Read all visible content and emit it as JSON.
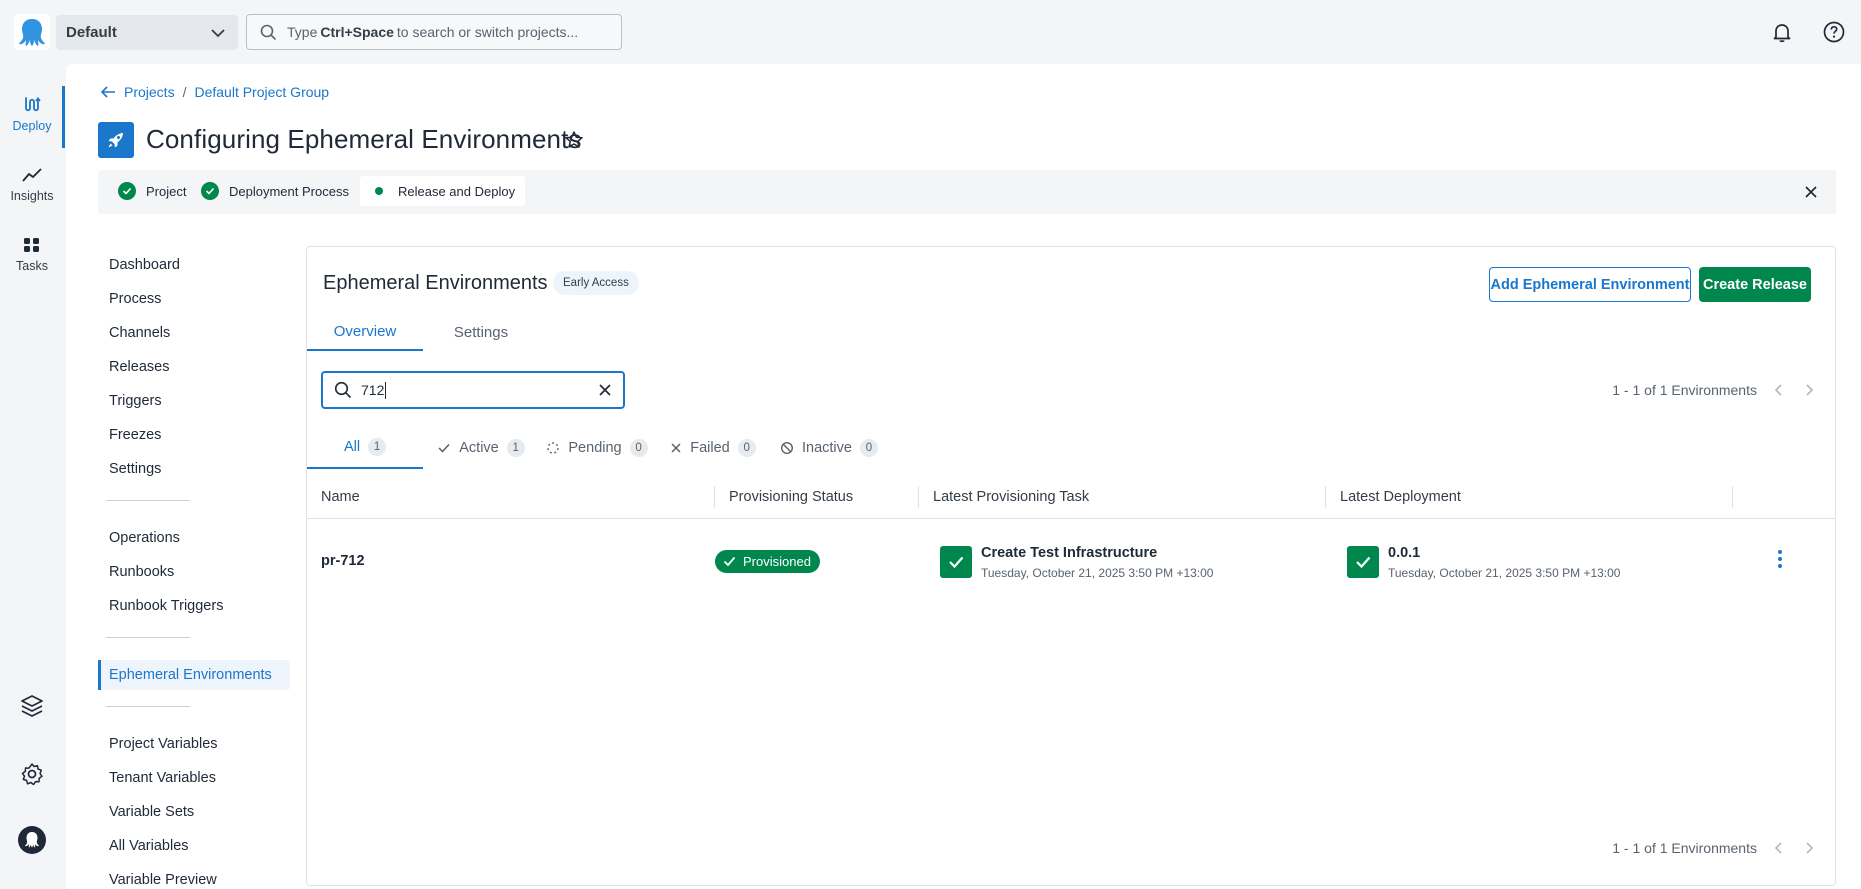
{
  "topbar": {
    "space_name": "Default",
    "search_prefix": "Type",
    "search_shortcut": "Ctrl+Space",
    "search_suffix": "to search or switch projects..."
  },
  "rail": {
    "items": [
      {
        "label": "Deploy",
        "icon": "deploy-icon"
      },
      {
        "label": "Insights",
        "icon": "insights-icon"
      },
      {
        "label": "Tasks",
        "icon": "tasks-icon"
      }
    ]
  },
  "breadcrumb": {
    "projects": "Projects",
    "sep": "/",
    "group": "Default Project Group"
  },
  "page": {
    "title": "Configuring Ephemeral Environments"
  },
  "steps": [
    {
      "label": "Project",
      "state": "done"
    },
    {
      "label": "Deployment Process",
      "state": "done"
    },
    {
      "label": "Release and Deploy",
      "state": "current"
    }
  ],
  "sidenav": {
    "group1": [
      "Dashboard",
      "Process",
      "Channels",
      "Releases",
      "Triggers",
      "Freezes",
      "Settings"
    ],
    "group2": [
      "Operations",
      "Runbooks",
      "Runbook Triggers"
    ],
    "group3": [
      "Ephemeral Environments"
    ],
    "group4": [
      "Project Variables",
      "Tenant Variables",
      "Variable Sets",
      "All Variables",
      "Variable Preview"
    ]
  },
  "card": {
    "title": "Ephemeral Environments",
    "badge": "Early Access",
    "add_button": "Add Ephemeral Environment",
    "create_button": "Create Release",
    "tabs": [
      "Overview",
      "Settings"
    ],
    "filter_value": "712",
    "pager_text": "1 - 1 of 1 Environments",
    "status_tabs": [
      {
        "label": "All",
        "count": "1"
      },
      {
        "label": "Active",
        "count": "1"
      },
      {
        "label": "Pending",
        "count": "0"
      },
      {
        "label": "Failed",
        "count": "0"
      },
      {
        "label": "Inactive",
        "count": "0"
      }
    ],
    "columns": [
      "Name",
      "Provisioning Status",
      "Latest Provisioning Task",
      "Latest Deployment"
    ],
    "rows": [
      {
        "name": "pr-712",
        "status": "Provisioned",
        "task_title": "Create Test Infrastructure",
        "task_time": "Tuesday, October 21, 2025 3:50 PM +13:00",
        "deploy_version": "0.0.1",
        "deploy_time": "Tuesday, October 21, 2025 3:50 PM +13:00"
      }
    ]
  },
  "colors": {
    "accent": "#1a77ca",
    "success": "#00874d",
    "text": "#1f2937",
    "muted": "#58636f"
  }
}
